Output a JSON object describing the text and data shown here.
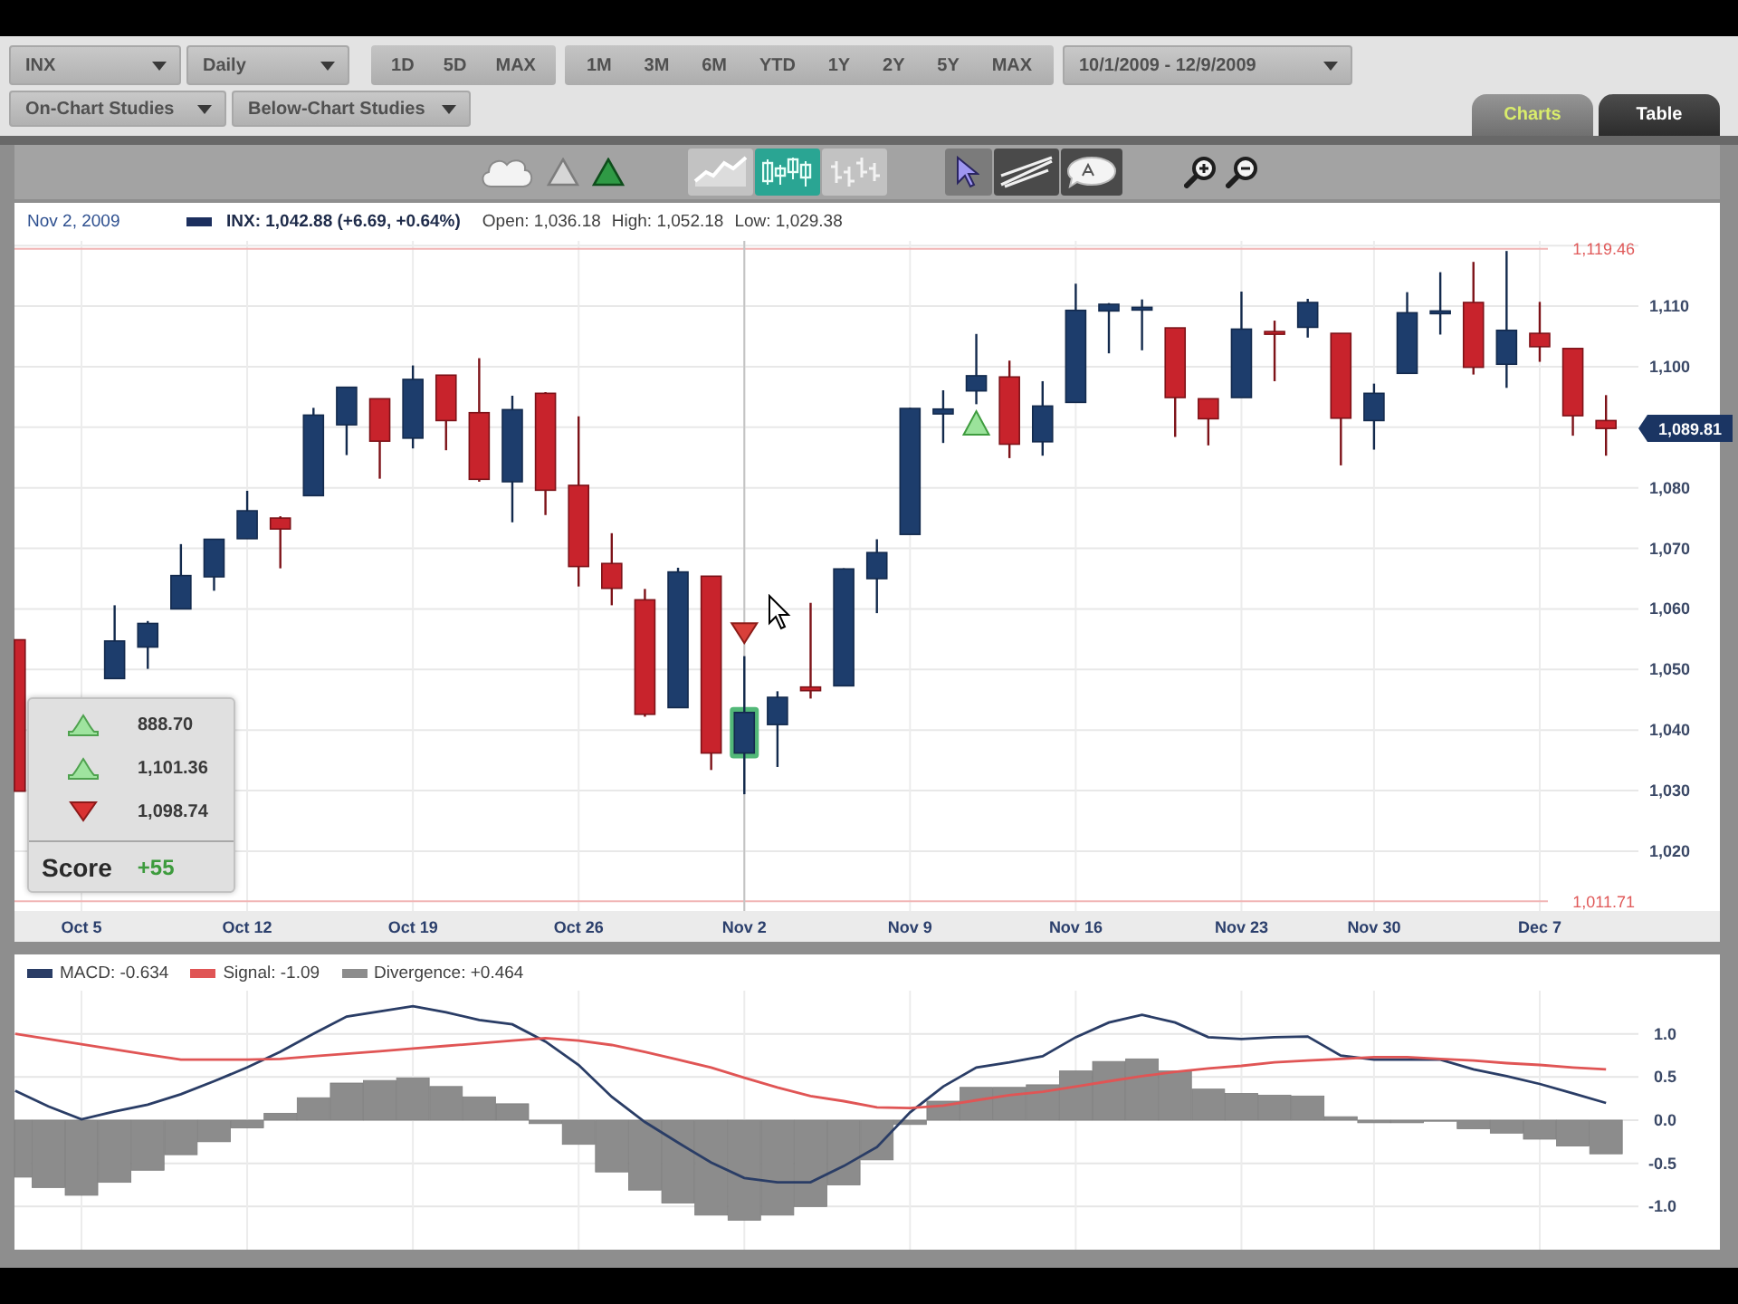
{
  "toolbar": {
    "symbol": {
      "value": "INX"
    },
    "interval": {
      "value": "Daily"
    },
    "period_groups": [
      {
        "buttons": [
          {
            "label": "1D",
            "selected": false
          },
          {
            "label": "5D",
            "selected": false
          },
          {
            "label": "MAX",
            "selected": false
          }
        ]
      },
      {
        "buttons": [
          {
            "label": "1M",
            "selected": false
          },
          {
            "label": "3M",
            "selected": false
          },
          {
            "label": "6M",
            "selected": false
          },
          {
            "label": "YTD",
            "selected": false
          },
          {
            "label": "1Y",
            "selected": false
          },
          {
            "label": "2Y",
            "selected": false
          },
          {
            "label": "5Y",
            "selected": false
          },
          {
            "label": "MAX",
            "selected": false
          }
        ]
      }
    ],
    "date_range": {
      "value": "10/1/2009 - 12/9/2009"
    },
    "studies": [
      {
        "label": "On-Chart Studies"
      },
      {
        "label": "Below-Chart Studies"
      }
    ]
  },
  "view_tabs": [
    {
      "label": "Charts",
      "selected": true
    },
    {
      "label": "Table",
      "selected": false
    }
  ],
  "chart_toolbar": {
    "signal_buttons": [
      {
        "kind": "cloud",
        "on": false
      },
      {
        "kind": "triangle",
        "on": false
      },
      {
        "kind": "triangle",
        "on": true
      }
    ],
    "chart_types": [
      {
        "kind": "line",
        "selected": false
      },
      {
        "kind": "candlestick",
        "selected": true
      },
      {
        "kind": "ohlc",
        "selected": false
      }
    ],
    "tools": [
      {
        "kind": "pointer",
        "selected": true
      },
      {
        "kind": "trendline",
        "selected": false
      },
      {
        "kind": "note",
        "selected": false
      }
    ],
    "zoom_buttons": [
      {
        "kind": "zoom-in"
      },
      {
        "kind": "zoom-out"
      }
    ]
  },
  "info_bar": {
    "date": "Nov 2, 2009",
    "quote": "INX: 1,042.88 (+6.69, +0.64%)",
    "open": "Open: 1,036.18",
    "high": "High: 1,052.18",
    "low": "Low: 1,029.38"
  },
  "price_chart": {
    "chart_data": {
      "type": "candlestick",
      "categories": [
        null,
        null,
        "Oct 5",
        null,
        null,
        null,
        null,
        "Oct 12",
        null,
        null,
        null,
        null,
        "Oct 19",
        null,
        null,
        null,
        null,
        "Oct 26",
        null,
        null,
        null,
        null,
        "Nov 2",
        null,
        null,
        null,
        null,
        "Nov 9",
        null,
        null,
        null,
        null,
        "Nov 16",
        null,
        null,
        null,
        null,
        "Nov 23",
        null,
        null,
        null,
        "Nov 30",
        null,
        null,
        null,
        null,
        "Dec 7",
        null,
        null
      ],
      "ohlc": [
        [
          1054.9,
          1054.9,
          1029.9,
          1029.9
        ],
        null,
        null,
        [
          1048.5,
          1060.6,
          1048.5,
          1054.7
        ],
        [
          1053.7,
          1058.0,
          1050.1,
          1057.6
        ],
        [
          1060.0,
          1070.7,
          1060.0,
          1065.5
        ],
        [
          1065.3,
          1071.5,
          1063.0,
          1071.5
        ],
        [
          1071.6,
          1079.5,
          1071.6,
          1076.2
        ],
        [
          1075.0,
          1075.3,
          1066.7,
          1073.2
        ],
        [
          1078.7,
          1093.2,
          1078.7,
          1092.0
        ],
        [
          1090.4,
          1096.6,
          1085.4,
          1096.6
        ],
        [
          1094.7,
          1094.7,
          1081.5,
          1087.7
        ],
        [
          1088.2,
          1100.2,
          1086.5,
          1097.9
        ],
        [
          1098.6,
          1098.6,
          1086.2,
          1091.1
        ],
        [
          1092.4,
          1101.4,
          1081.0,
          1081.4
        ],
        [
          1081.0,
          1095.2,
          1074.3,
          1092.9
        ],
        [
          1095.6,
          1095.8,
          1075.5,
          1079.6
        ],
        [
          1080.4,
          1091.8,
          1063.7,
          1067.0
        ],
        [
          1067.5,
          1072.5,
          1060.6,
          1063.4
        ],
        [
          1061.5,
          1063.3,
          1042.2,
          1042.6
        ],
        [
          1043.7,
          1066.8,
          1043.7,
          1066.1
        ],
        [
          1065.4,
          1065.4,
          1033.4,
          1036.2
        ],
        [
          1036.2,
          1052.2,
          1029.4,
          1042.9
        ],
        [
          1040.9,
          1046.4,
          1033.9,
          1045.4
        ],
        [
          1047.1,
          1061.0,
          1045.2,
          1046.5
        ],
        [
          1047.3,
          1066.7,
          1047.3,
          1066.6
        ],
        [
          1065.0,
          1071.5,
          1059.3,
          1069.3
        ],
        [
          1072.3,
          1093.2,
          1072.3,
          1093.1
        ],
        [
          1092.2,
          1096.1,
          1087.4,
          1093.0
        ],
        [
          1096.0,
          1105.4,
          1093.8,
          1098.5
        ],
        [
          1098.3,
          1101.0,
          1084.9,
          1087.2
        ],
        [
          1087.6,
          1097.6,
          1085.3,
          1093.5
        ],
        [
          1094.1,
          1113.7,
          1094.1,
          1109.3
        ],
        [
          1109.2,
          1110.5,
          1102.2,
          1110.3
        ],
        [
          1109.4,
          1111.1,
          1102.7,
          1109.8
        ],
        [
          1106.4,
          1106.4,
          1088.4,
          1094.9
        ],
        [
          1094.7,
          1094.7,
          1087.0,
          1091.4
        ],
        [
          1094.9,
          1112.4,
          1094.9,
          1106.2
        ],
        [
          1105.8,
          1107.6,
          1097.6,
          1105.7
        ],
        [
          1106.5,
          1111.2,
          1104.8,
          1110.6
        ],
        [
          1105.5,
          1105.5,
          1083.7,
          1091.5
        ],
        [
          1091.1,
          1097.2,
          1086.3,
          1095.6
        ],
        [
          1098.9,
          1112.3,
          1098.9,
          1108.9
        ],
        [
          1109.0,
          1115.6,
          1105.3,
          1109.2
        ],
        [
          1110.6,
          1117.3,
          1098.7,
          1099.9
        ],
        [
          1100.4,
          1119.1,
          1096.5,
          1106.0
        ],
        [
          1105.5,
          1110.7,
          1100.8,
          1103.3
        ],
        [
          1103.0,
          1103.0,
          1088.6,
          1091.9
        ],
        [
          1091.1,
          1095.3,
          1085.3,
          1089.8
        ]
      ],
      "ylim": [
        1010.12,
        1120.77
      ],
      "yticks": [
        {
          "value": 1110,
          "label": "1,110"
        },
        {
          "value": 1100,
          "label": "1,100"
        },
        {
          "value": 1080,
          "label": "1,080"
        },
        {
          "value": 1070,
          "label": "1,070"
        },
        {
          "value": 1060,
          "label": "1,060"
        },
        {
          "value": 1050,
          "label": "1,050"
        },
        {
          "value": 1040,
          "label": "1,040"
        },
        {
          "value": 1030,
          "label": "1,030"
        },
        {
          "value": 1020,
          "label": "1,020"
        }
      ],
      "grid": true,
      "ref_lines": [
        {
          "axis": "y",
          "value": 1119.46,
          "label": "1,119.46"
        },
        {
          "axis": "y",
          "value": 1011.71,
          "label": "1,011.71"
        },
        {
          "axis": "x",
          "value": "Nov 2"
        }
      ],
      "annotations": [
        "1,089.81"
      ]
    }
  },
  "score_panel": {
    "signals": [
      {
        "kind": "up",
        "value": "888.70"
      },
      {
        "kind": "up",
        "value": "1,101.36"
      },
      {
        "kind": "down",
        "value": "1,098.74"
      }
    ],
    "label": "Score",
    "score": "+55"
  },
  "macd_panel": {
    "chart_data": {
      "type": "line",
      "ylim": [
        -1.5,
        1.5
      ],
      "yticks": [
        {
          "value": 1,
          "label": "1.0"
        },
        {
          "value": 0.5,
          "label": "0.5"
        },
        {
          "value": 0,
          "label": "0.0"
        },
        {
          "value": -0.5,
          "label": "-0.5"
        },
        {
          "value": -1,
          "label": "-1.0"
        }
      ],
      "grid": true,
      "series": [
        {
          "name": "MACD: -0.634",
          "color": "#2a3d66",
          "values": [
            0.34,
            0.16,
            0.01,
            0.1,
            0.18,
            0.3,
            0.45,
            0.61,
            0.79,
            1.0,
            1.2,
            1.26,
            1.32,
            1.25,
            1.16,
            1.11,
            0.91,
            0.64,
            0.27,
            -0.02,
            -0.26,
            -0.49,
            -0.67,
            -0.72,
            -0.72,
            -0.53,
            -0.31,
            0.09,
            0.39,
            0.61,
            0.67,
            0.74,
            0.96,
            1.13,
            1.22,
            1.13,
            0.96,
            0.94,
            0.96,
            0.97,
            0.75,
            0.7,
            0.7,
            0.7,
            0.59,
            0.51,
            0.42,
            0.31,
            0.2
          ]
        },
        {
          "name": "Signal: -1.09",
          "color": "#e05555",
          "values": [
            1.0,
            0.94,
            0.88,
            0.82,
            0.76,
            0.7,
            0.7,
            0.7,
            0.71,
            0.74,
            0.77,
            0.8,
            0.83,
            0.86,
            0.89,
            0.92,
            0.95,
            0.92,
            0.87,
            0.79,
            0.7,
            0.61,
            0.49,
            0.38,
            0.28,
            0.22,
            0.15,
            0.14,
            0.17,
            0.23,
            0.29,
            0.33,
            0.39,
            0.45,
            0.51,
            0.56,
            0.6,
            0.63,
            0.67,
            0.69,
            0.71,
            0.73,
            0.73,
            0.71,
            0.69,
            0.66,
            0.64,
            0.61,
            0.59
          ]
        },
        {
          "name": "Divergence: +0.464",
          "type": "bar",
          "color": "#8c8c8c",
          "values": [
            -0.66,
            -0.78,
            -0.87,
            -0.72,
            -0.58,
            -0.4,
            -0.25,
            -0.09,
            0.08,
            0.26,
            0.43,
            0.46,
            0.49,
            0.39,
            0.27,
            0.19,
            -0.04,
            -0.28,
            -0.6,
            -0.81,
            -0.96,
            -1.1,
            -1.16,
            -1.1,
            -1.0,
            -0.75,
            -0.46,
            -0.05,
            0.22,
            0.38,
            0.38,
            0.41,
            0.57,
            0.68,
            0.71,
            0.57,
            0.36,
            0.31,
            0.29,
            0.28,
            0.04,
            -0.03,
            -0.03,
            -0.01,
            -0.1,
            -0.15,
            -0.22,
            -0.3,
            -0.39
          ]
        }
      ]
    }
  }
}
